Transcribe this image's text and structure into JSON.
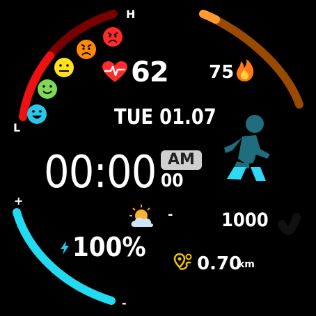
{
  "heart_rate": {
    "value": "62",
    "levels": {
      "high_label": "H",
      "low_label": "L"
    }
  },
  "calories": {
    "value": "75"
  },
  "date": {
    "text": "TUE 01.07"
  },
  "time": {
    "hhmm": "00:00",
    "seconds": "00",
    "ampm": "AM"
  },
  "steps": {
    "value": "1000",
    "goal_progress": 0.0
  },
  "weather": {
    "temp": "-"
  },
  "battery": {
    "value": "100%",
    "scale_max": "+",
    "scale_min": "-",
    "level": 1.0
  },
  "distance": {
    "value": "0.70",
    "unit": "km"
  },
  "colors": {
    "heart": "#ff2b2b",
    "calories_arc": "#9a4a00",
    "calories_accent": "#ff9b2e",
    "battery_arc": "#22dbf0",
    "walker_body": "#1f6d7d",
    "walker_legs": "#2fd9f5",
    "distance_icon": "#f5c400"
  },
  "icons": {
    "heart": "heart-pulse-icon",
    "calories": "flame-icon",
    "weather": "partly-cloudy-icon",
    "battery": "lightning-icon",
    "distance": "route-pin-icon",
    "steps": "walking-person-icon"
  }
}
